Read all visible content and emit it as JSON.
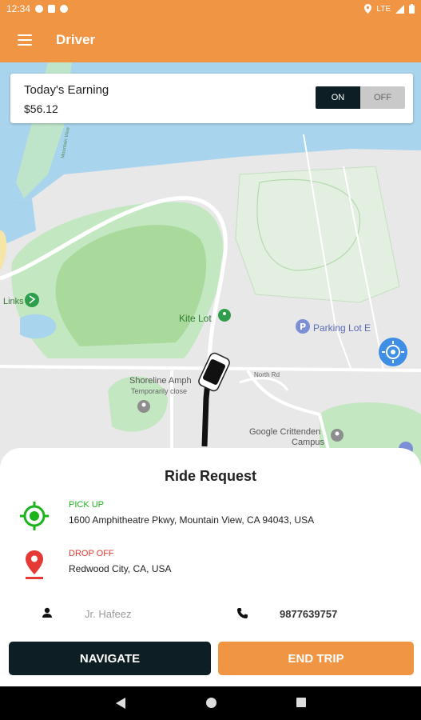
{
  "status_bar": {
    "time": "12:34",
    "network": "LTE"
  },
  "app_bar": {
    "title": "Driver",
    "menu_icon": "hamburger-menu-icon"
  },
  "earnings": {
    "label": "Today's Earning",
    "amount": "$56.12",
    "toggle_on": "ON",
    "toggle_off": "OFF",
    "selected": "ON"
  },
  "map": {
    "labels": {
      "kite_lot": "Kite Lot",
      "parking_lot": "Parking Lot E",
      "shoreline": "Shoreline Amph",
      "shoreline_status": "Temporarily close",
      "north_rd": "North Rd",
      "google_crittenden_1": "Google Crittenden",
      "google_crittenden_2": "Campus",
      "links": "Links",
      "road_label": "Mountain View"
    }
  },
  "ride_request": {
    "title": "Ride Request",
    "pickup": {
      "caption": "PICK UP",
      "address": "1600 Amphitheatre Pkwy, Mountain View, CA 94043, USA"
    },
    "dropoff": {
      "caption": "DROP OFF",
      "address": "Redwood City, CA, USA"
    },
    "rider_name": "Jr. Hafeez",
    "rider_phone": "9877639757"
  },
  "actions": {
    "navigate": "NAVIGATE",
    "end_trip": "END TRIP"
  },
  "colors": {
    "accent": "#ef9544",
    "dark": "#0d1f25",
    "pickup": "#1db31d",
    "dropoff": "#e53935"
  }
}
